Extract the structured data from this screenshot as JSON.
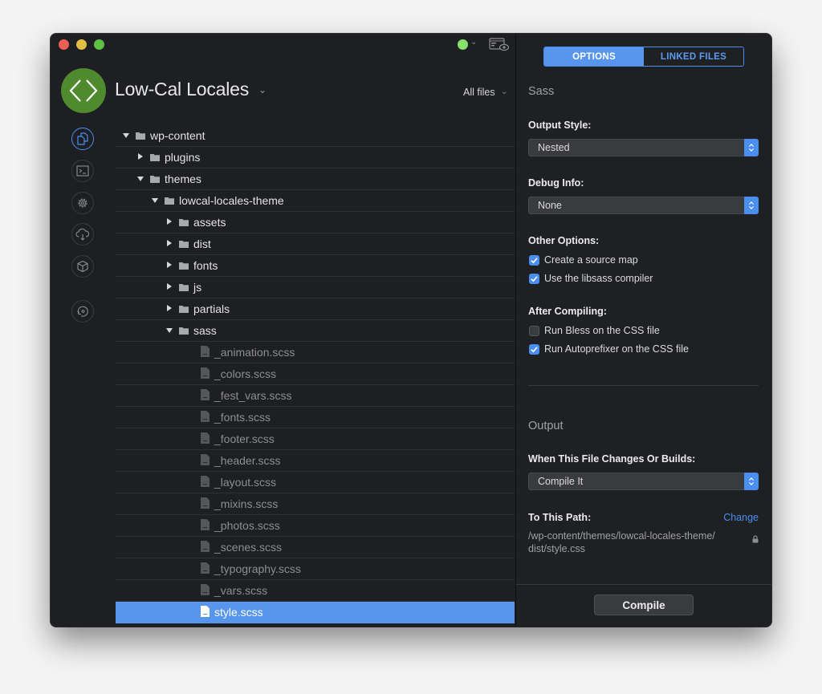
{
  "window": {
    "project": {
      "title": "Low-Cal Locales",
      "logo_icon": "code-brackets-icon",
      "logo_color": "#4f8a2f"
    },
    "file_filter": "All files",
    "status_color": "#86e06b"
  },
  "sidebar": {
    "items": [
      {
        "name": "files",
        "icon": "files-icon",
        "active": true
      },
      {
        "name": "terminal",
        "icon": "terminal-icon",
        "active": false
      },
      {
        "name": "settings",
        "icon": "gear-icon",
        "active": false
      },
      {
        "name": "deploy",
        "icon": "cloud-download-icon",
        "active": false
      },
      {
        "name": "packages",
        "icon": "cube-icon",
        "active": false
      },
      {
        "name": "refresh",
        "icon": "refresh-disc-icon",
        "active": false
      }
    ]
  },
  "tree": {
    "rows": [
      {
        "label": "wp-content",
        "type": "folder",
        "depth": 0,
        "expanded": true
      },
      {
        "label": "plugins",
        "type": "folder",
        "depth": 1,
        "expanded": false
      },
      {
        "label": "themes",
        "type": "folder",
        "depth": 1,
        "expanded": true
      },
      {
        "label": "lowcal-locales-theme",
        "type": "folder",
        "depth": 2,
        "expanded": true
      },
      {
        "label": "assets",
        "type": "folder",
        "depth": 3,
        "expanded": false
      },
      {
        "label": "dist",
        "type": "folder",
        "depth": 3,
        "expanded": false
      },
      {
        "label": "fonts",
        "type": "folder",
        "depth": 3,
        "expanded": false
      },
      {
        "label": "js",
        "type": "folder",
        "depth": 3,
        "expanded": false
      },
      {
        "label": "partials",
        "type": "folder",
        "depth": 3,
        "expanded": false
      },
      {
        "label": "sass",
        "type": "folder",
        "depth": 3,
        "expanded": true
      },
      {
        "label": "_animation.scss",
        "type": "file",
        "depth": 4
      },
      {
        "label": "_colors.scss",
        "type": "file",
        "depth": 4
      },
      {
        "label": "_fest_vars.scss",
        "type": "file",
        "depth": 4
      },
      {
        "label": "_fonts.scss",
        "type": "file",
        "depth": 4
      },
      {
        "label": "_footer.scss",
        "type": "file",
        "depth": 4
      },
      {
        "label": "_header.scss",
        "type": "file",
        "depth": 4
      },
      {
        "label": "_layout.scss",
        "type": "file",
        "depth": 4
      },
      {
        "label": "_mixins.scss",
        "type": "file",
        "depth": 4
      },
      {
        "label": "_photos.scss",
        "type": "file",
        "depth": 4
      },
      {
        "label": "_scenes.scss",
        "type": "file",
        "depth": 4
      },
      {
        "label": "_typography.scss",
        "type": "file",
        "depth": 4
      },
      {
        "label": "_vars.scss",
        "type": "file",
        "depth": 4
      },
      {
        "label": "style.scss",
        "type": "file",
        "depth": 4,
        "selected": true
      }
    ]
  },
  "inspector": {
    "tabs": [
      {
        "label": "OPTIONS",
        "active": true
      },
      {
        "label": "LINKED FILES",
        "active": false
      }
    ],
    "sass_section": "Sass",
    "output_style": {
      "label": "Output Style:",
      "value": "Nested"
    },
    "debug_info": {
      "label": "Debug Info:",
      "value": "None"
    },
    "other_options": {
      "label": "Other Options:",
      "items": [
        {
          "label": "Create a source map",
          "checked": true
        },
        {
          "label": "Use the libsass compiler",
          "checked": true
        }
      ]
    },
    "after_compiling": {
      "label": "After Compiling:",
      "items": [
        {
          "label": "Run Bless on the CSS file",
          "checked": false
        },
        {
          "label": "Run Autoprefixer on the CSS file",
          "checked": true
        }
      ]
    },
    "output_section": "Output",
    "when_changes": {
      "label": "When This File Changes Or Builds:",
      "value": "Compile It"
    },
    "to_path": {
      "label": "To This Path:",
      "change_label": "Change",
      "path_line1": "/wp-content/themes/lowcal-locales-theme/",
      "path_line2": "dist/style.css"
    },
    "compile_button": "Compile",
    "accent_color": "#4a8ff0"
  }
}
